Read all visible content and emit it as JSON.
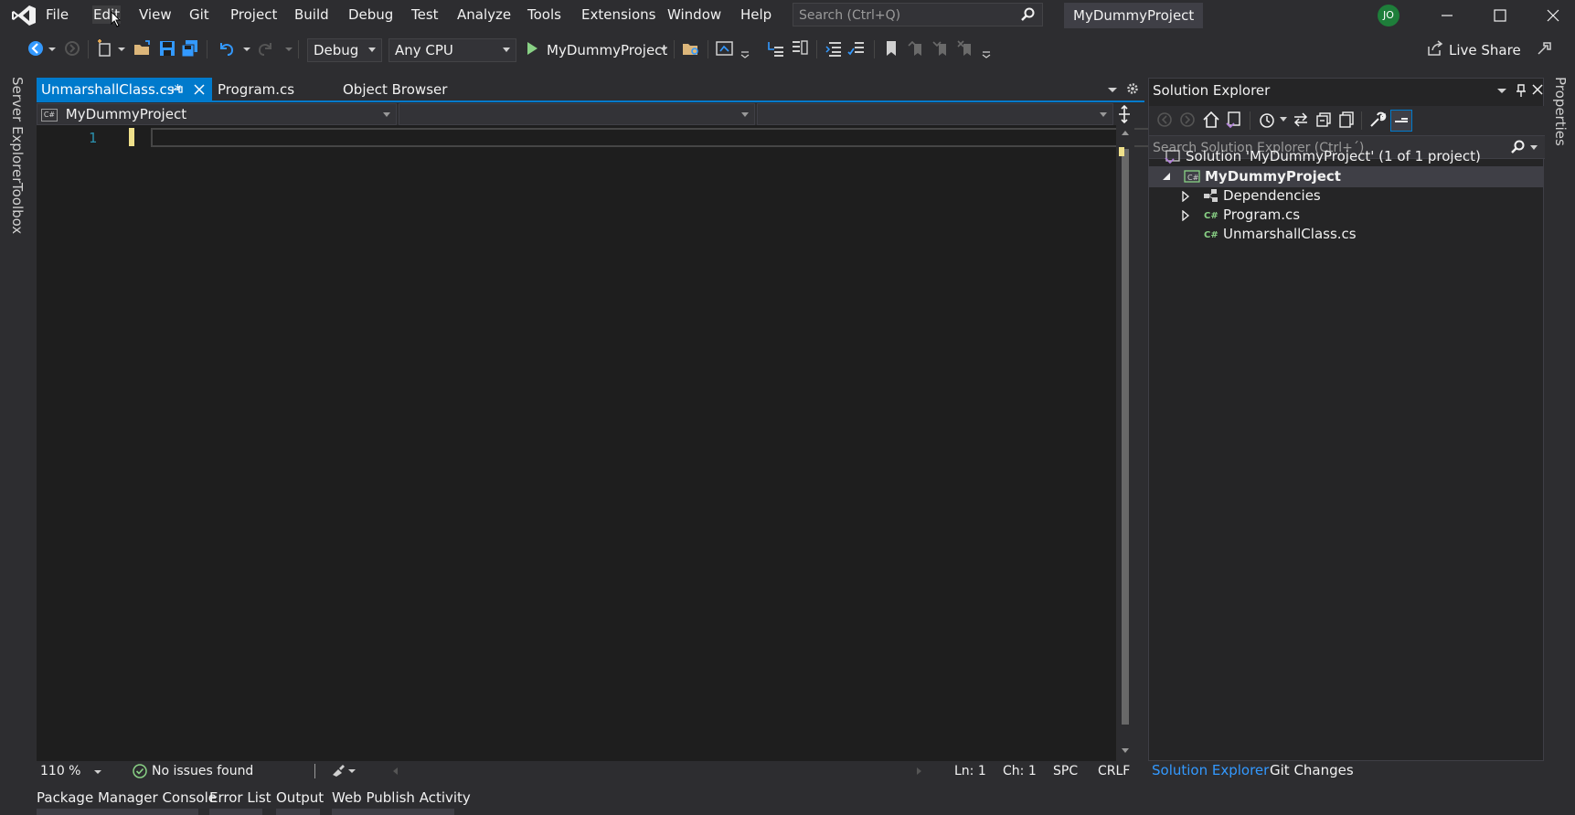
{
  "menubar": {
    "items": [
      "File",
      "Edit",
      "View",
      "Git",
      "Project",
      "Build",
      "Debug",
      "Test",
      "Analyze",
      "Tools",
      "Extensions",
      "Window",
      "Help"
    ],
    "search_placeholder": "Search (Ctrl+Q)",
    "project_name": "MyDummyProject",
    "user_initials": "JO"
  },
  "toolbar": {
    "configuration": "Debug",
    "platform": "Any CPU",
    "run_target": "MyDummyProject",
    "live_share": "Live Share"
  },
  "left_strip": {
    "tabs": [
      "Server Explorer",
      "Toolbox"
    ]
  },
  "editor": {
    "tabs": [
      {
        "label": "UnmarshallClass.cs*",
        "active": true
      },
      {
        "label": "Program.cs",
        "active": false
      },
      {
        "label": "Object Browser",
        "active": false
      }
    ],
    "nav_project": "MyDummyProject",
    "nav_project_badge": "C#",
    "line_numbers": [
      "1"
    ],
    "status": {
      "zoom": "110 %",
      "issues": "No issues found",
      "line": "Ln: 1",
      "char": "Ch: 1",
      "whitespace": "SPC",
      "line_ending": "CRLF"
    }
  },
  "solution_explorer": {
    "title": "Solution Explorer",
    "search_placeholder": "Search Solution Explorer (Ctrl+´)",
    "tree": [
      {
        "label": "Solution 'MyDummyProject' (1 of 1 project)",
        "icon": "solution-icon",
        "bold": false
      },
      {
        "label": "MyDummyProject",
        "icon": "csharp-project-icon",
        "bold": true,
        "selected": true
      },
      {
        "label": "Dependencies",
        "icon": "dependencies-icon",
        "bold": false
      },
      {
        "label": "Program.cs",
        "icon": "csharp-file-icon",
        "bold": false
      },
      {
        "label": "UnmarshallClass.cs",
        "icon": "csharp-file-icon",
        "bold": false
      }
    ],
    "bottom_tabs": [
      {
        "label": "Solution Explorer",
        "active": true
      },
      {
        "label": "Git Changes",
        "active": false
      }
    ]
  },
  "right_strip": {
    "tabs": [
      "Properties"
    ]
  },
  "bottom_panel": {
    "tabs": [
      "Package Manager Console",
      "Error List",
      "Output",
      "Web Publish Activity"
    ]
  },
  "colors": {
    "accent": "#007acc",
    "background": "#2d2d30",
    "editor_bg": "#1e1e1e",
    "modified_marker": "#efe08a",
    "active_panel_tab": "#3399ff"
  }
}
